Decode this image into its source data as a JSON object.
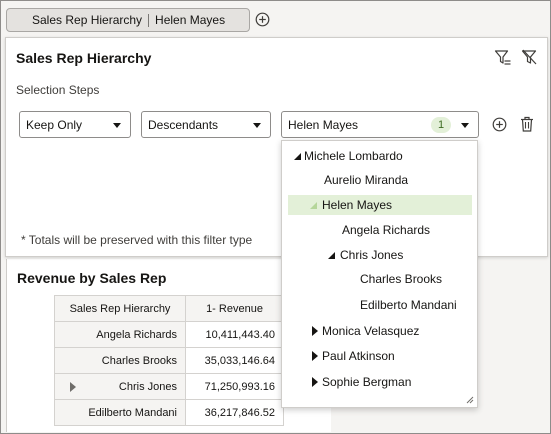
{
  "filter_chip": {
    "dimension": "Sales Rep Hierarchy",
    "value": "Helen Mayes"
  },
  "filter_panel": {
    "title": "Sales Rep Hierarchy",
    "steps_label": "Selection Steps",
    "action_select": "Keep Only",
    "relation_select": "Descendants",
    "member_select": "Helen Mayes",
    "member_count": "1",
    "totals_note": "* Totals will be preserved with this filter type"
  },
  "report": {
    "title": "Revenue by Sales Rep",
    "columns": [
      "Sales Rep Hierarchy",
      "1- Revenue"
    ],
    "rows": [
      {
        "name": "Angela Richards",
        "revenue": "10,411,443.40"
      },
      {
        "name": "Charles Brooks",
        "revenue": "35,033,146.64"
      },
      {
        "name": "Chris Jones",
        "revenue": "71,250,993.16"
      },
      {
        "name": "Edilberto Mandani",
        "revenue": "36,217,846.52"
      }
    ]
  },
  "tree": {
    "items": [
      {
        "label": "Michele Lombardo",
        "state": "expanded"
      },
      {
        "label": "Aurelio Miranda",
        "state": "leaf"
      },
      {
        "label": "Helen Mayes",
        "state": "expanded",
        "selected": true
      },
      {
        "label": "Angela Richards",
        "state": "leaf"
      },
      {
        "label": "Chris Jones",
        "state": "expanded"
      },
      {
        "label": "Charles Brooks",
        "state": "leaf"
      },
      {
        "label": "Edilberto Mandani",
        "state": "leaf"
      },
      {
        "label": "Monica Velasquez",
        "state": "collapsed"
      },
      {
        "label": "Paul Atkinson",
        "state": "collapsed"
      },
      {
        "label": "Sophie Bergman",
        "state": "collapsed"
      }
    ]
  },
  "colors": {
    "selected_bg": "#e3f0d8",
    "badge_text": "#3d6b21"
  },
  "icons": [
    "add-circle-icon",
    "filter-icon",
    "clear-filter-icon",
    "delete-icon",
    "caret-down-icon",
    "expand-triangle-icon",
    "resize-grip-icon"
  ]
}
